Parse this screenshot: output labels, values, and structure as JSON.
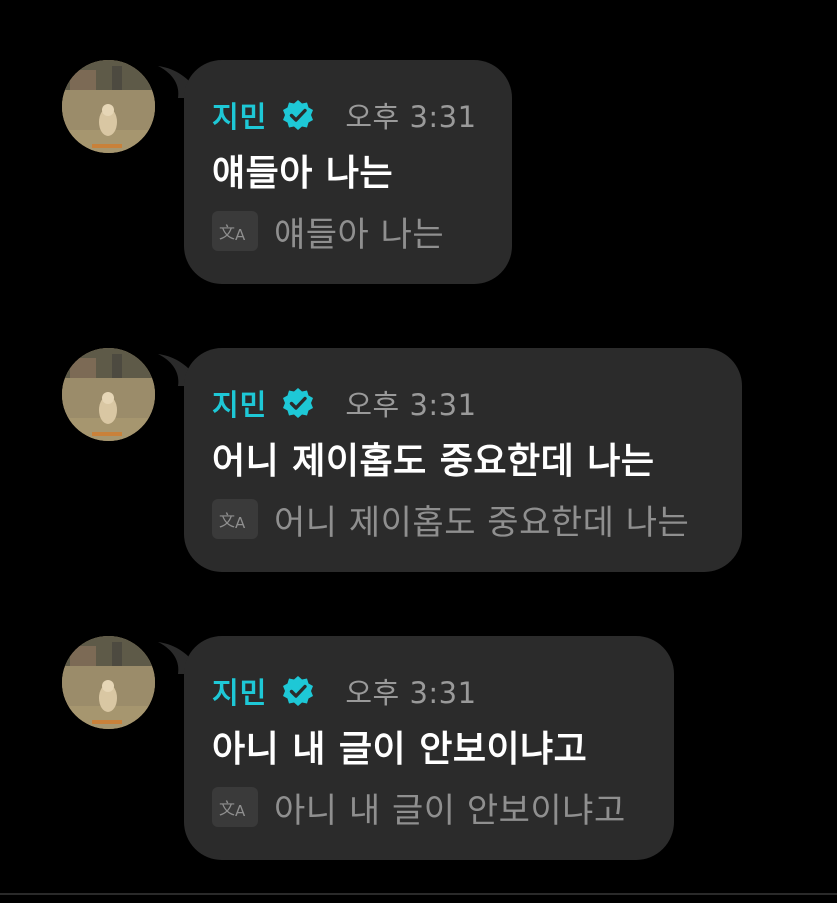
{
  "messages": [
    {
      "sender": "지민",
      "time": "오후 3:31",
      "text": "얘들아 나는",
      "translation": "얘들아 나는"
    },
    {
      "sender": "지민",
      "time": "오후 3:31",
      "text": "어니 제이홉도 중요한데 나는",
      "translation": "어니 제이홉도 중요한데 나는"
    },
    {
      "sender": "지민",
      "time": "오후 3:31",
      "text": "아니 내 글이 안보이냐고",
      "translation": "아니 내 글이 안보이냐고"
    }
  ],
  "icons": {
    "verified": "verified-badge-icon",
    "translate": "translate-icon"
  },
  "colors": {
    "background": "#000000",
    "bubble": "#2b2b2b",
    "sender_name": "#1ec8d6",
    "verified_badge": "#1ec8d6",
    "message_text": "#ffffff",
    "muted_text": "#9a9a9a"
  }
}
